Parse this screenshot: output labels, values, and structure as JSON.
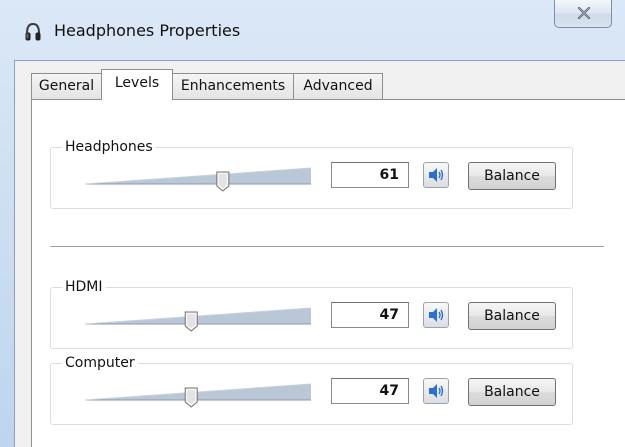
{
  "window": {
    "title": "Headphones Properties"
  },
  "tabs": [
    {
      "label": "General",
      "selected": false
    },
    {
      "label": "Levels",
      "selected": true
    },
    {
      "label": "Enhancements",
      "selected": false
    },
    {
      "label": "Advanced",
      "selected": false
    }
  ],
  "devices": [
    {
      "name": "Headphones",
      "level": 61,
      "level_text": "61",
      "balance_label": "Balance"
    },
    {
      "name": "HDMI",
      "level": 47,
      "level_text": "47",
      "balance_label": "Balance"
    },
    {
      "name": "Computer",
      "level": 47,
      "level_text": "47",
      "balance_label": "Balance"
    }
  ],
  "icons": {
    "title": "headphones-icon",
    "close": "close-icon",
    "speaker": "speaker-icon"
  },
  "colors": {
    "speaker_blue": "#2b6fd6",
    "slider_track": "#b9c7d6"
  }
}
